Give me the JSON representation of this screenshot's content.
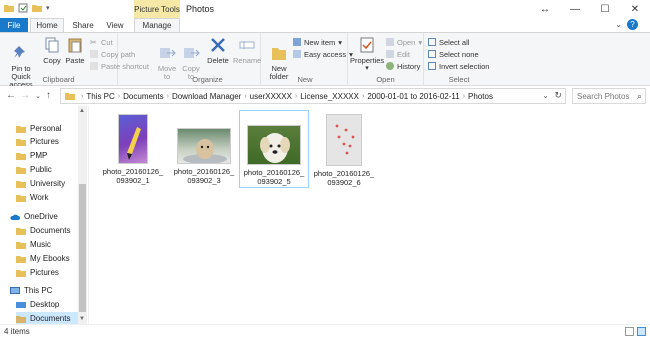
{
  "window": {
    "context_tab": "Picture Tools",
    "title": "Photos",
    "icons": [
      "folder-icon",
      "properties-icon",
      "new-folder-icon",
      "dropdown-icon"
    ]
  },
  "tabs": {
    "file": "File",
    "home": "Home",
    "share": "Share",
    "view": "View",
    "manage": "Manage"
  },
  "ribbon": {
    "clipboard": {
      "label": "Clipboard",
      "pin": "Pin to Quick\naccess",
      "copy": "Copy",
      "paste": "Paste",
      "cut": "Cut",
      "copy_path": "Copy path",
      "paste_shortcut": "Paste shortcut"
    },
    "organize": {
      "label": "Organize",
      "move_to": "Move\nto",
      "copy_to": "Copy\nto",
      "delete": "Delete",
      "rename": "Rename"
    },
    "new": {
      "label": "New",
      "new_folder": "New\nfolder",
      "new_item": "New item",
      "easy_access": "Easy access"
    },
    "open": {
      "label": "Open",
      "properties": "Properties",
      "open": "Open",
      "edit": "Edit",
      "history": "History"
    },
    "select": {
      "label": "Select",
      "select_all": "Select all",
      "select_none": "Select none",
      "invert": "Invert selection"
    }
  },
  "address": {
    "crumbs": [
      "This PC",
      "Documents",
      "Download Manager",
      "userXXXXX",
      "License_XXXXX",
      "2000-01-01 to 2016-02-11",
      "Photos"
    ],
    "search_placeholder": "Search Photos"
  },
  "nav": {
    "quick": [
      "Personal",
      "Pictures",
      "PMP",
      "Public",
      "University",
      "Work"
    ],
    "onedrive": "OneDrive",
    "onedrive_items": [
      "Documents",
      "Music",
      "My Ebooks",
      "Pictures"
    ],
    "thispc": "This PC",
    "thispc_items": [
      "Desktop",
      "Documents"
    ]
  },
  "files": [
    {
      "name": "photo_20160126_\n093902_1"
    },
    {
      "name": "photo_20160126_\n093902_3"
    },
    {
      "name": "photo_20160126_\n093902_5"
    },
    {
      "name": "photo_20160126_\n093902_6"
    }
  ],
  "status": {
    "count": "4 items"
  },
  "colors": {
    "accent": "#1979ca",
    "selection": "#cce8ff",
    "context_tab": "#f6e8a6"
  }
}
